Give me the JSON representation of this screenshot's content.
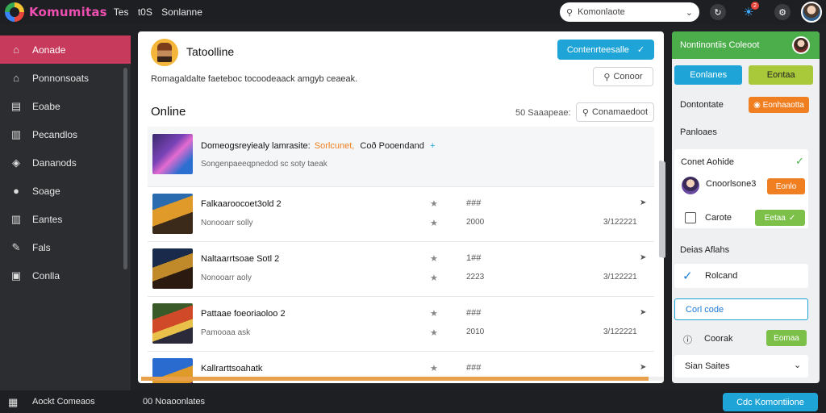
{
  "app": {
    "brand": "Komumitas",
    "topnav": [
      "Tes",
      "t0S",
      "Sonlanne"
    ],
    "search_placeholder": "Komonlaote",
    "notification_count": "2"
  },
  "sidebar": {
    "items": [
      {
        "label": "Aonade",
        "icon": "home-icon",
        "glyph": "⌂"
      },
      {
        "label": "Ponnonsoats",
        "icon": "house-icon",
        "glyph": "⌂"
      },
      {
        "label": "Eoabe",
        "icon": "document-icon",
        "glyph": "▤"
      },
      {
        "label": "Pecandlos",
        "icon": "chart-icon",
        "glyph": "▥"
      },
      {
        "label": "Dananods",
        "icon": "tag-icon",
        "glyph": "◈"
      },
      {
        "label": "Soage",
        "icon": "paint-icon",
        "glyph": "●"
      },
      {
        "label": "Eantes",
        "icon": "chart-bar-icon",
        "glyph": "▥"
      },
      {
        "label": "Fals",
        "icon": "edit-icon",
        "glyph": "✎"
      },
      {
        "label": "Conlla",
        "icon": "panel-icon",
        "glyph": "▣"
      }
    ]
  },
  "main": {
    "title": "Tatoolline",
    "cta_label": "Contenrteesalle",
    "description": "Romagaldalte faeteboc tocoodeaack amgyb ceaeak.",
    "secondary_button": "Conoor",
    "section_title": "Online",
    "count_label": "50 Saaapeae:",
    "filter_button": "Conamaedoot",
    "featured": {
      "title": "Domeogsreyiealy lamrasite:",
      "highlight": "Sorlcunet,",
      "highlight2": "Coð Pooendand",
      "plus": "+",
      "subtitle": "Songenpaeeqpnedod sc soty taeak"
    },
    "rows": [
      {
        "title": "Falkaaroocoet3old 2",
        "subtitle": "Nonooarr solly",
        "hash": "###",
        "number": "2000",
        "date": "3/122221"
      },
      {
        "title": "Naltaarrtsoae Sotl 2",
        "subtitle": "Nonooarr aoly",
        "hash": "1##",
        "number": "2223",
        "date": "3/122221"
      },
      {
        "title": "Pattaae foeoriaoloo 2",
        "subtitle": "Pamooaa ask",
        "hash": "###",
        "number": "2010",
        "date": "3/122221"
      },
      {
        "title": "Kallrarttsoahatk",
        "subtitle": "",
        "hash": "###",
        "number": "",
        "date": ""
      }
    ],
    "progress": 0.97
  },
  "right": {
    "header": "Nontinontiis Coleoot",
    "tab1": "Eonlanes",
    "tab2": "Eontaa",
    "row1_label": "Dontontate",
    "row1_button": "Eonhaaotta",
    "row2_label": "Panloaes",
    "card1_title": "Conet Aohide",
    "user_name": "Cnoorlsone3",
    "user_button": "Eonlo",
    "checkbox_label": "Carote",
    "checkbox_button": "Eetaa",
    "section2": "Deias Aflahs",
    "checked_label": "Rolcand",
    "link_label": "Corl code",
    "info_label": "Coorak",
    "info_button": "Eomaa",
    "dropdown": "Sian Saites"
  },
  "bottom": {
    "left_label": "Aockt Comeaos",
    "mid_label": "00 Noaoonlates",
    "button": "Cdc Komontiione"
  },
  "colors": {
    "accent_blue": "#1ea4d6",
    "active_sidebar": "#c73a5c",
    "green": "#4cae4a",
    "orange": "#f07f22",
    "lime": "#a9c83a"
  }
}
